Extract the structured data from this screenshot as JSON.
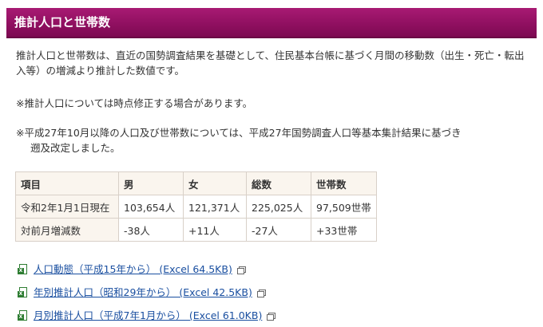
{
  "header": {
    "title": "推計人口と世帯数"
  },
  "intro": {
    "p1": "推計人口と世帯数は、直近の国勢調査結果を基礎として、住民基本台帳に基づく月間の移動数（出生・死亡・転出入等）の増減より推計した数値です。",
    "p2": "※推計人口については時点修正する場合があります。",
    "p3_line1": "※平成27年10月以降の人口及び世帯数については、平成27年国勢調査人口等基本集計結果に基づき",
    "p3_line2": "遡及改定しました。"
  },
  "table": {
    "headers": [
      "項目",
      "男",
      "女",
      "総数",
      "世帯数"
    ],
    "rows": [
      [
        "令和2年1月1日現在",
        "103,654人",
        "121,371人",
        "225,025人",
        "97,509世帯"
      ],
      [
        "対前月増減数",
        "-38人",
        "+11人",
        "-27人",
        "+33世帯"
      ]
    ]
  },
  "downloads": [
    {
      "label": "人口動態（平成15年から） (Excel 64.5KB)",
      "icon": "excel-file-icon"
    },
    {
      "label": "年別推計人口（昭和29年から） (Excel 42.5KB)",
      "icon": "excel-file-icon"
    },
    {
      "label": "月別推計人口（平成7年1月から） (Excel 61.0KB)",
      "icon": "excel-file-icon"
    }
  ],
  "colors": {
    "header_bg": "#8e0f5f",
    "link": "#1a4fa0",
    "table_header_bg": "#faf5ee"
  }
}
